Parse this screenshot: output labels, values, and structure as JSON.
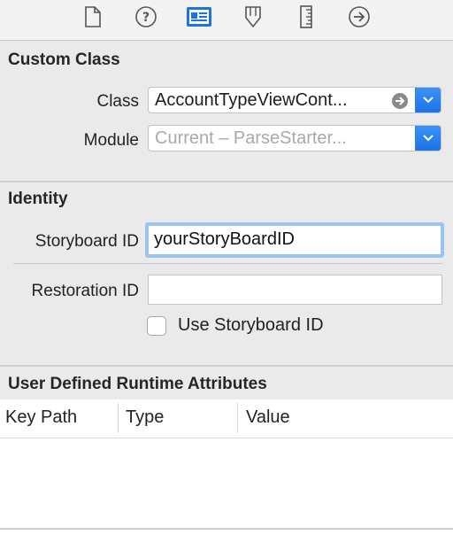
{
  "toolbar": {
    "tabs": [
      {
        "icon": "file-icon"
      },
      {
        "icon": "help-icon"
      },
      {
        "icon": "identity-inspector-icon",
        "selected": true
      },
      {
        "icon": "attributes-inspector-icon"
      },
      {
        "icon": "size-inspector-icon"
      },
      {
        "icon": "connections-inspector-icon"
      }
    ]
  },
  "custom_class": {
    "title": "Custom Class",
    "class_label": "Class",
    "class_value": "AccountTypeViewCont...",
    "module_label": "Module",
    "module_placeholder": "Current – ParseStarter..."
  },
  "identity": {
    "title": "Identity",
    "storyboard_id_label": "Storyboard ID",
    "storyboard_id_value": "yourStoryBoardID",
    "restoration_id_label": "Restoration ID",
    "restoration_id_value": "",
    "use_storyboard_id_label": "Use Storyboard ID",
    "use_storyboard_id_checked": false
  },
  "runtime_attributes": {
    "title": "User Defined Runtime Attributes",
    "columns": [
      "Key Path",
      "Type",
      "Value"
    ],
    "rows": []
  },
  "colors": {
    "accent": "#1a73e8",
    "focus_ring": "#9cc4f2"
  }
}
